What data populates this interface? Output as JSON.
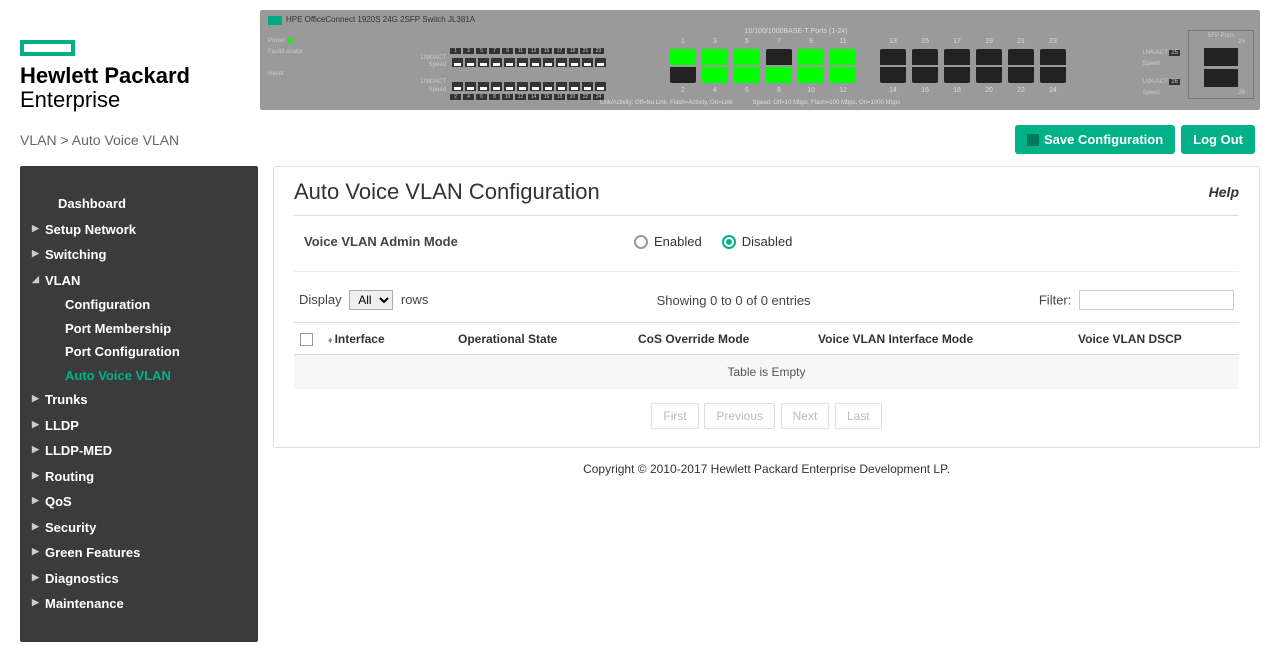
{
  "brand": {
    "line1": "Hewlett Packard",
    "line2": "Enterprise"
  },
  "device": {
    "model": "HPE OfficeConnect 1920S 24G 2SFP Switch JL381A",
    "ports_title": "10/100/1000BASE-T Ports (1-24)",
    "sfp_title": "SFP Ports",
    "sfp_ports": [
      "25",
      "26"
    ],
    "leds": {
      "power": "Power",
      "fault": "Fault/Locator",
      "reset": "Reset"
    },
    "lnkact": "LNK/ACT",
    "speed": "Speed",
    "legend": {
      "link": "Link/Activity: Off=No Link, Flash=Activity, On=Link",
      "speed": "Speed: Off=10 Mbps, Flash=100 Mbps, On=1000 Mbps"
    },
    "top_odd": [
      "1",
      "3",
      "5",
      "7",
      "9",
      "11"
    ],
    "bot_even": [
      "2",
      "4",
      "6",
      "8",
      "10",
      "12"
    ],
    "top_odd2": [
      "13",
      "15",
      "17",
      "19",
      "21",
      "23"
    ],
    "bot_even2": [
      "14",
      "16",
      "18",
      "20",
      "22",
      "24"
    ],
    "active_ports_top": [
      true,
      true,
      true,
      false,
      true,
      true
    ],
    "active_ports_bot": [
      false,
      true,
      true,
      true,
      true,
      true
    ],
    "mini_top": [
      "1",
      "3",
      "5",
      "7",
      "9",
      "11",
      "13",
      "15",
      "17",
      "19",
      "21",
      "23"
    ],
    "mini_bot": [
      "2",
      "4",
      "6",
      "8",
      "10",
      "12",
      "14",
      "16",
      "18",
      "20",
      "22",
      "24"
    ]
  },
  "breadcrumb": "VLAN > Auto Voice VLAN",
  "buttons": {
    "save": "Save Configuration",
    "logout": "Log Out"
  },
  "sidebar": {
    "dashboard": "Dashboard",
    "setup": "Setup Network",
    "switching": "Switching",
    "vlan": "VLAN",
    "vlan_sub": {
      "config": "Configuration",
      "portmem": "Port Membership",
      "portcfg": "Port Configuration",
      "auto": "Auto Voice VLAN"
    },
    "trunks": "Trunks",
    "lldp": "LLDP",
    "lldpmed": "LLDP-MED",
    "routing": "Routing",
    "qos": "QoS",
    "security": "Security",
    "green": "Green Features",
    "diag": "Diagnostics",
    "maint": "Maintenance"
  },
  "panel": {
    "title": "Auto Voice VLAN Configuration",
    "help": "Help",
    "admin_label": "Voice VLAN Admin Mode",
    "enabled": "Enabled",
    "disabled": "Disabled",
    "display": "Display",
    "rows": "rows",
    "all": "All",
    "showing": "Showing 0 to 0 of 0 entries",
    "filter": "Filter:",
    "cols": {
      "iface": "Interface",
      "op": "Operational State",
      "cos": "CoS Override Mode",
      "vim": "Voice VLAN Interface Mode",
      "dscp": "Voice VLAN DSCP"
    },
    "empty": "Table is Empty",
    "pager": {
      "first": "First",
      "prev": "Previous",
      "next": "Next",
      "last": "Last"
    }
  },
  "footer": "Copyright © 2010-2017 Hewlett Packard Enterprise Development LP."
}
